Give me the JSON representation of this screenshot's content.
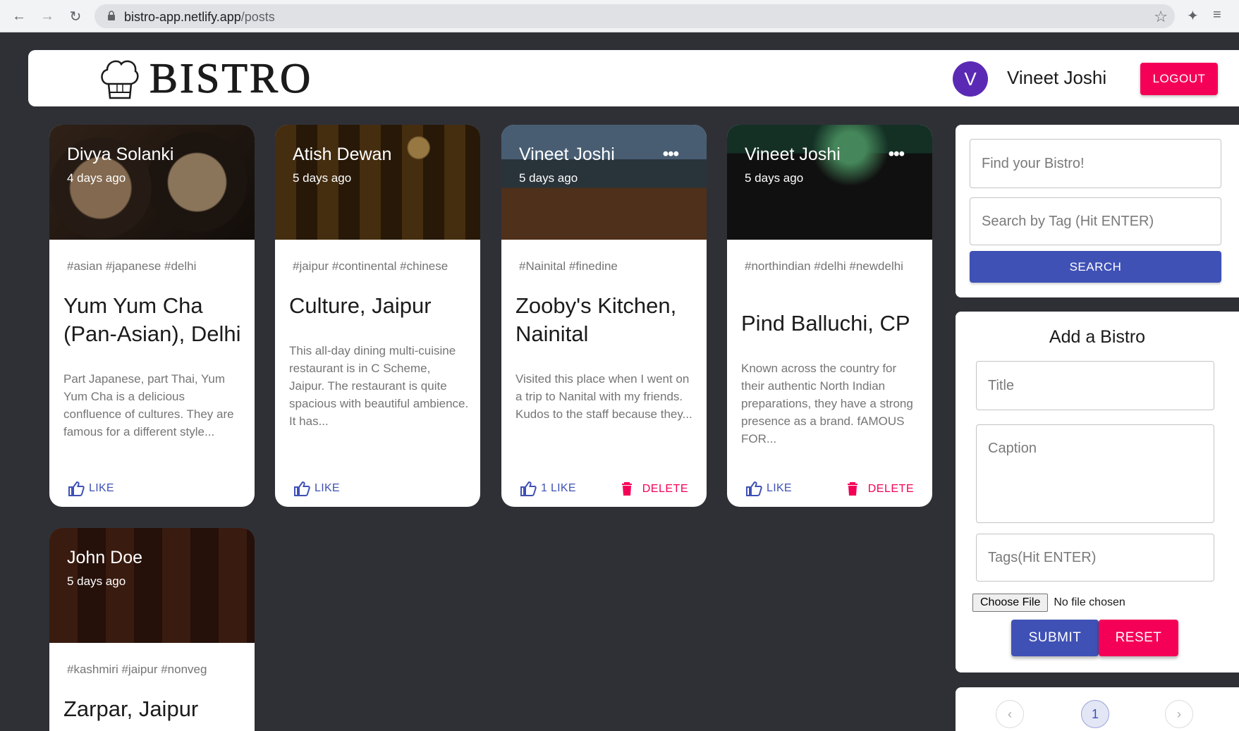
{
  "browser": {
    "url_host": "bistro-app.netlify.app",
    "url_path": "/posts"
  },
  "header": {
    "brand": "BISTRO",
    "avatar_letter": "V",
    "user_name": "Vineet Joshi",
    "logout_label": "LOGOUT"
  },
  "posts": [
    {
      "author": "Divya Solanki",
      "time": "4 days ago",
      "tags": "#asian #japanese #delhi",
      "title": "Yum Yum Cha (Pan-Asian), Delhi",
      "body": "Part Japanese, part Thai, Yum Yum Cha is a delicious confluence of cultures. They are famous for a different style...",
      "like_label": "LIKE"
    },
    {
      "author": "Atish Dewan",
      "time": "5 days ago",
      "tags": "#jaipur #continental #chinese",
      "title": "Culture, Jaipur",
      "body": "This all-day dining multi-cuisine restaurant is in C Scheme, Jaipur. The restaurant is quite spacious with beautiful ambience. It has...",
      "like_label": "LIKE"
    },
    {
      "author": "Vineet Joshi",
      "time": "5 days ago",
      "tags": "#Nainital #finedine",
      "title": "Zooby's Kitchen, Nainital",
      "body": "Visited this place when I went on a trip to Nanital with my friends. Kudos to the staff because they...",
      "like_label": "1 LIKE",
      "delete_label": "DELETE",
      "more": "•••"
    },
    {
      "author": "Vineet Joshi",
      "time": "5 days ago",
      "tags": "#northindian #delhi #newdelhi",
      "title": "Pind Balluchi, CP",
      "body": "Known across the country for their authentic North Indian preparations, they have a strong presence as a brand. fAMOUS FOR...",
      "like_label": "LIKE",
      "delete_label": "DELETE",
      "more": "•••"
    },
    {
      "author": "John Doe",
      "time": "5 days ago",
      "tags": "#kashmiri #jaipur #nonveg",
      "title": "Zarpar, Jaipur"
    }
  ],
  "search": {
    "find_placeholder": "Find your Bistro!",
    "tag_placeholder": "Search by Tag (Hit ENTER)",
    "button_label": "SEARCH"
  },
  "form": {
    "heading": "Add a Bistro",
    "title_placeholder": "Title",
    "caption_placeholder": "Caption",
    "tags_placeholder": "Tags(Hit ENTER)",
    "file_button": "Choose File",
    "file_status": "No file chosen",
    "submit_label": "SUBMIT",
    "reset_label": "RESET"
  },
  "pagination": {
    "prev": "‹",
    "current": "1",
    "next": "›"
  },
  "colors": {
    "primary": "#3f51b5",
    "secondary": "#f50057",
    "avatar": "#5b2ab5",
    "background": "#2f3036"
  }
}
